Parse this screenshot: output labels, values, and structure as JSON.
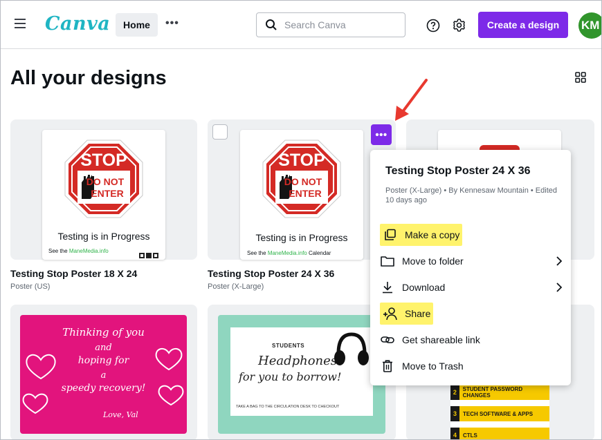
{
  "header": {
    "logo": "Canva",
    "home_tab": "Home",
    "more": "•••",
    "search_placeholder": "Search Canva",
    "create_button": "Create a design",
    "avatar_initials": "KM"
  },
  "page": {
    "title": "All your designs"
  },
  "designs": [
    {
      "title": "Testing Stop Poster 18 X 24",
      "type": "Poster (US)",
      "poster_line": "Testing is in Progress",
      "poster_small_prefix": "See the ",
      "poster_small_link": "ManeMedia.info",
      "poster_small_suffix": ""
    },
    {
      "title": "Testing Stop Poster 24 X 36",
      "type": "Poster (X-Large)",
      "poster_line": "Testing is in Progress",
      "poster_small_prefix": "See the ",
      "poster_small_link": "ManeMedia.info",
      "poster_small_suffix": " Calendar"
    }
  ],
  "stop_sign": {
    "stop": "STOP",
    "do_not": "DO NOT",
    "enter": "ENTER"
  },
  "menu": {
    "title": "Testing Stop Poster 24 X 36",
    "meta": "Poster (X-Large) • By Kennesaw Mountain • Edited 10 days ago",
    "items": [
      {
        "label": "Make a copy",
        "icon": "copy-icon"
      },
      {
        "label": "Move to folder",
        "icon": "folder-icon"
      },
      {
        "label": "Download",
        "icon": "download-icon"
      },
      {
        "label": "Share",
        "icon": "share-people-icon"
      },
      {
        "label": "Get shareable link",
        "icon": "link-icon"
      },
      {
        "label": "Move to Trash",
        "icon": "trash-icon"
      }
    ]
  },
  "pink_card": {
    "line1": "Thinking of you",
    "line2": "and",
    "line3": "hoping for",
    "line4": "a",
    "line5": "speedy recovery!",
    "signature": "Love, Val"
  },
  "green_card": {
    "heading": "STUDENTS",
    "line1": "Headphones",
    "line2": "for you to borrow!",
    "footer": "TAKE A BAG TO THE CIRCULATION DESK TO CHECKOUT"
  },
  "yellow_card": {
    "rows": [
      {
        "num": "2",
        "text": "STUDENT PASSWORD CHANGES"
      },
      {
        "num": "3",
        "text": "TECH SOFTWARE & APPS"
      },
      {
        "num": "4",
        "text": "CTLS"
      }
    ]
  },
  "colors": {
    "brand_purple": "#7d2ae8",
    "highlight_yellow": "#fff36c",
    "avatar_green": "#31952c",
    "annotation_red": "#e8392f"
  }
}
